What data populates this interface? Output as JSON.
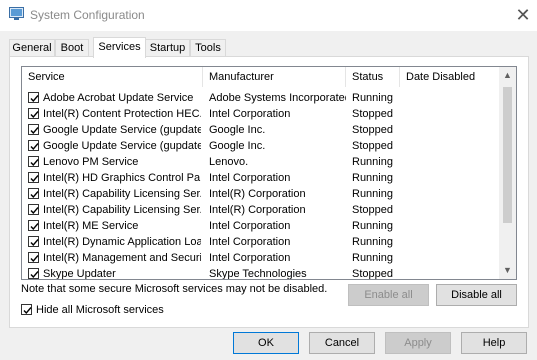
{
  "window": {
    "title": "System Configuration"
  },
  "tabs": [
    "General",
    "Boot",
    "Services",
    "Startup",
    "Tools"
  ],
  "columns": [
    "Service",
    "Manufacturer",
    "Status",
    "Date Disabled"
  ],
  "services": [
    {
      "name": "Adobe Acrobat Update Service",
      "manufacturer": "Adobe Systems Incorporated",
      "status": "Running"
    },
    {
      "name": "Intel(R) Content Protection HEC...",
      "manufacturer": "Intel Corporation",
      "status": "Stopped"
    },
    {
      "name": "Google Update Service (gupdate)",
      "manufacturer": "Google Inc.",
      "status": "Stopped"
    },
    {
      "name": "Google Update Service (gupdatem)",
      "manufacturer": "Google Inc.",
      "status": "Stopped"
    },
    {
      "name": "Lenovo PM Service",
      "manufacturer": "Lenovo.",
      "status": "Running"
    },
    {
      "name": "Intel(R) HD Graphics Control Pa...",
      "manufacturer": "Intel Corporation",
      "status": "Running"
    },
    {
      "name": "Intel(R) Capability Licensing Ser...",
      "manufacturer": "Intel(R) Corporation",
      "status": "Running"
    },
    {
      "name": "Intel(R) Capability Licensing Ser...",
      "manufacturer": "Intel(R) Corporation",
      "status": "Stopped"
    },
    {
      "name": "Intel(R) ME Service",
      "manufacturer": "Intel Corporation",
      "status": "Running"
    },
    {
      "name": "Intel(R) Dynamic Application Loa...",
      "manufacturer": "Intel Corporation",
      "status": "Running"
    },
    {
      "name": "Intel(R) Management and Securi...",
      "manufacturer": "Intel Corporation",
      "status": "Running"
    },
    {
      "name": "Skype Updater",
      "manufacturer": "Skype Technologies",
      "status": "Stopped"
    }
  ],
  "note": "Note that some secure Microsoft services may not be disabled.",
  "buttons": {
    "enable_all": "Enable all",
    "disable_all": "Disable all",
    "ok": "OK",
    "cancel": "Cancel",
    "apply": "Apply",
    "help": "Help"
  },
  "hide_ms": {
    "label": "Hide all Microsoft services",
    "checked": true
  }
}
